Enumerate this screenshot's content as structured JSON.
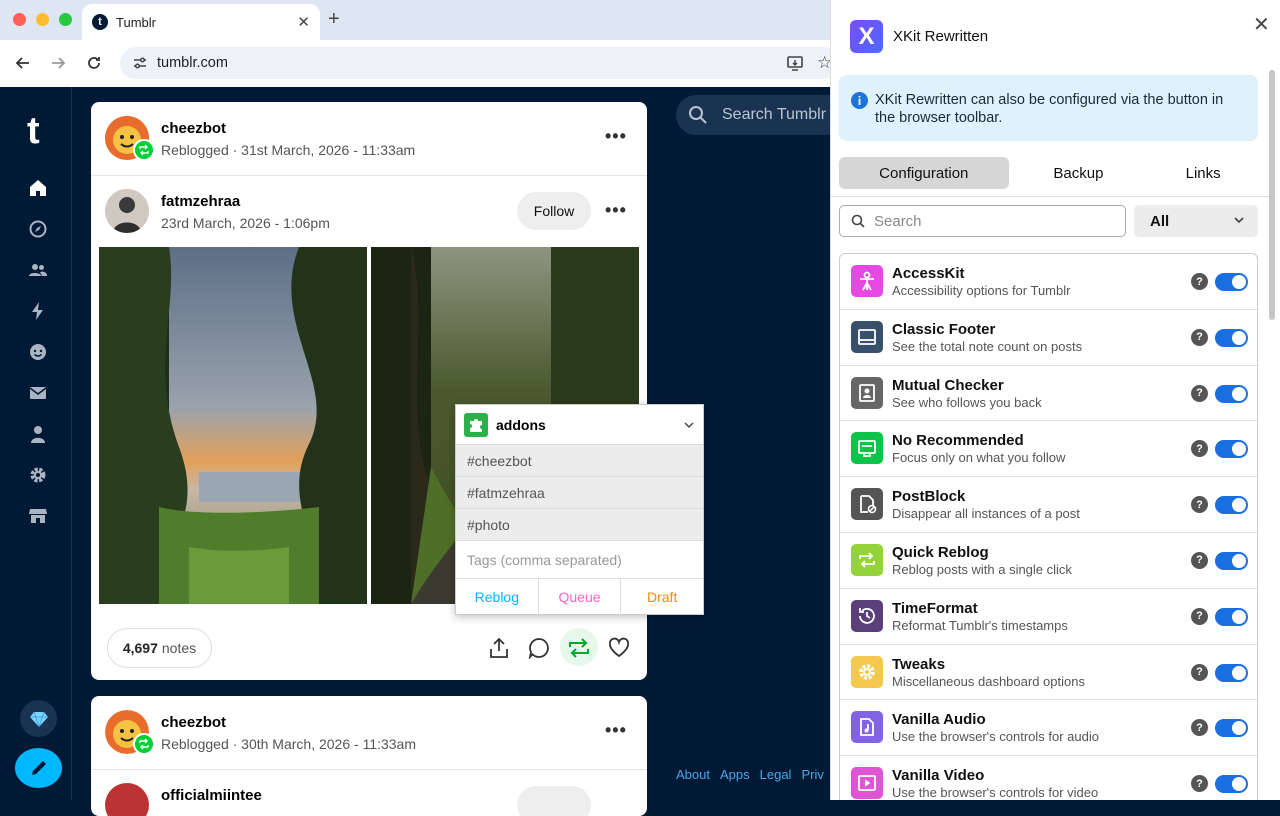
{
  "browser": {
    "tab_title": "Tumblr",
    "url": "tumblr.com",
    "new_tab_symbol": "+"
  },
  "tumblr": {
    "logo": "t",
    "search_placeholder": "Search Tumblr",
    "posts": [
      {
        "reblogger": "cheezbot",
        "reblog_meta": "Reblogged · 31st March, 2026 - 11:33am",
        "author": "fatmzehraa",
        "author_meta": "23rd March, 2026 - 1:06pm",
        "follow_label": "Follow",
        "notes_count": "4,697",
        "notes_label": "notes"
      },
      {
        "reblogger": "cheezbot",
        "reblog_meta": "Reblogged · 30th March, 2026 - 11:33am",
        "author": "officialmiintee"
      }
    ],
    "footer_links": [
      "About",
      "Apps",
      "Legal",
      "Priv"
    ]
  },
  "quick_reblog": {
    "blog": "addons",
    "tags": [
      "#cheezbot",
      "#fatmzehraa",
      "#photo"
    ],
    "tags_placeholder": "Tags (comma separated)",
    "buttons": {
      "reblog": "Reblog",
      "queue": "Queue",
      "draft": "Draft"
    },
    "colors": {
      "reblog": "#00b8ff",
      "queue": "#ff62ce",
      "draft": "#ff8a00"
    }
  },
  "xkit": {
    "title": "XKit Rewritten",
    "logo_letter": "X",
    "info": "XKit Rewritten can also be configured via the button in the browser toolbar.",
    "tabs": [
      "Configuration",
      "Backup",
      "Links"
    ],
    "search_placeholder": "Search",
    "filter_value": "All",
    "features": [
      {
        "name": "AccessKit",
        "desc": "Accessibility options for Tumblr",
        "color": "#e649e2",
        "icon": "accessibility-icon"
      },
      {
        "name": "Classic Footer",
        "desc": "See the total note count on posts",
        "color": "#39506b",
        "icon": "footer-icon"
      },
      {
        "name": "Mutual Checker",
        "desc": "See who follows you back",
        "color": "#666666",
        "icon": "contact-icon"
      },
      {
        "name": "No Recommended",
        "desc": "Focus only on what you follow",
        "color": "#0cc44a",
        "icon": "no-recommended-icon"
      },
      {
        "name": "PostBlock",
        "desc": "Disappear all instances of a post",
        "color": "#555555",
        "icon": "block-post-icon"
      },
      {
        "name": "Quick Reblog",
        "desc": "Reblog posts with a single click",
        "color": "#94d43a",
        "icon": "reblog-icon"
      },
      {
        "name": "TimeFormat",
        "desc": "Reformat Tumblr's timestamps",
        "color": "#5a3f78",
        "icon": "history-icon"
      },
      {
        "name": "Tweaks",
        "desc": "Miscellaneous dashboard options",
        "color": "#f2c94c",
        "icon": "gear-icon"
      },
      {
        "name": "Vanilla Audio",
        "desc": "Use the browser's controls for audio",
        "color": "#8263e6",
        "icon": "audio-icon"
      },
      {
        "name": "Vanilla Video",
        "desc": "Use the browser's controls for video",
        "color": "#e055d6",
        "icon": "video-icon"
      }
    ]
  }
}
